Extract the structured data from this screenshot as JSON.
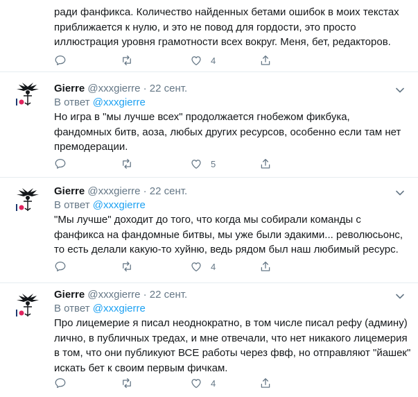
{
  "tweet0": {
    "lines": [
      "ради фанфикса. Количество найденных бетами ошибок в моих текстах",
      "приближается к нулю, и это не повод для гордости, это просто",
      "иллюстрация уровня грамотности всех вокруг. Меня, бет, редакторов."
    ],
    "likes": "4"
  },
  "tweets": [
    {
      "name": "Gierre",
      "handle": "@xxxgierre",
      "dot": "·",
      "date": "22 сент.",
      "reply_prefix": "В ответ",
      "reply_handle": "@xxxgierre",
      "lines": [
        "Но игра в \"мы лучше всех\" продолжается гнобежом фикбука,",
        "фандомных битв, аоза, любых других ресурсов, особенно если там нет",
        "премодерации."
      ],
      "likes": "5"
    },
    {
      "name": "Gierre",
      "handle": "@xxxgierre",
      "dot": "·",
      "date": "22 сент.",
      "reply_prefix": "В ответ",
      "reply_handle": "@xxxgierre",
      "lines": [
        "\"Мы лучше\" доходит до того, что когда мы собирали команды с",
        "фанфикса на фандомные битвы, мы уже были эдакими... революсьонс,",
        "то есть делали какую-то хуйню, ведь рядом был наш любимый ресурс."
      ],
      "likes": "4"
    },
    {
      "name": "Gierre",
      "handle": "@xxxgierre",
      "dot": "·",
      "date": "22 сент.",
      "reply_prefix": "В ответ",
      "reply_handle": "@xxxgierre",
      "lines": [
        "Про лицемерие я писал неоднократно, в том числе писал рефу (админу)",
        "лично, в публичных тредах, и мне отвечали, что нет никакого лицемерия",
        "в том, что они публикуют ВСЕ работы через фвф, но отправляют \"йашек\"",
        "искать бет к своим первым фичкам."
      ],
      "likes": "4"
    }
  ]
}
